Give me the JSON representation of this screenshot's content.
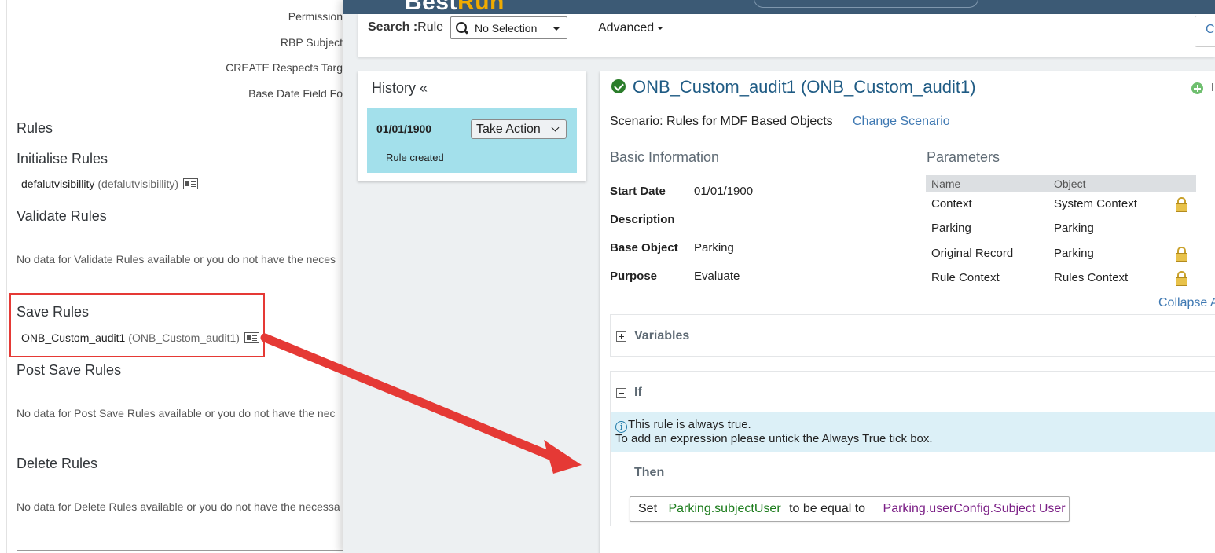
{
  "left_panel": {
    "fields": [
      "Permission",
      "RBP Subject",
      "CREATE Respects Targ",
      "Base Date Field Fo"
    ],
    "rules_heading": "Rules",
    "initialise": {
      "heading": "Initialise Rules",
      "rule_name": "defalutvisibillity",
      "rule_id": "(defalutvisibillity)"
    },
    "validate": {
      "heading": "Validate Rules",
      "no_data": "No data for Validate Rules available or you do not have the neces"
    },
    "save": {
      "heading": "Save Rules",
      "rule_name": "ONB_Custom_audit1",
      "rule_id": "(ONB_Custom_audit1)"
    },
    "post_save": {
      "heading": "Post Save Rules",
      "no_data": "No data for Post Save Rules available or you do not have the nec"
    },
    "delete": {
      "heading": "Delete Rules",
      "no_data": "No data for Delete Rules available or you do not have the necessa"
    }
  },
  "overlay": {
    "brand": {
      "part1": "Best",
      "part2": "Run"
    },
    "search": {
      "label_bold": "Search :",
      "label_rest": "Rule",
      "selected": "No Selection",
      "advanced": "Advanced",
      "edge_button": "C"
    },
    "history": {
      "title": "History «",
      "date": "01/01/1900",
      "take_action": "Take Action",
      "note": "Rule created"
    },
    "detail": {
      "title": "ONB_Custom_audit1 (ONB_Custom_audit1)",
      "add_label": "I",
      "scenario": "Scenario: Rules for MDF Based Objects",
      "change_scenario": "Change Scenario",
      "basic_info": {
        "title": "Basic Information",
        "rows": [
          {
            "label": "Start Date",
            "value": "01/01/1900"
          },
          {
            "label": "Description",
            "value": ""
          },
          {
            "label": "Base Object",
            "value": "Parking"
          },
          {
            "label": "Purpose",
            "value": "Evaluate"
          }
        ]
      },
      "parameters": {
        "title": "Parameters",
        "headers": [
          "Name",
          "Object"
        ],
        "rows": [
          {
            "name": "Context",
            "object": "System Context",
            "locked": true
          },
          {
            "name": "Parking",
            "object": "Parking",
            "locked": false
          },
          {
            "name": "Original Record",
            "object": "Parking",
            "locked": true
          },
          {
            "name": "Rule Context",
            "object": "Rules Context",
            "locked": true
          }
        ],
        "collapse": "Collapse A"
      },
      "variables_label": "Variables",
      "if_label": "If",
      "info_line1": "This rule is always true.",
      "info_line2": "To add an expression please untick the Always True tick box.",
      "then_label": "Then",
      "set_statement": {
        "keyword": "Set",
        "lhs": "Parking.subjectUser",
        "operator": "to be equal to",
        "rhs": "Parking.userConfig.Subject User"
      }
    }
  },
  "colors": {
    "shell": "#3c5a75",
    "brand_accent": "#f0ab00",
    "history_item": "#a3e0eb",
    "link": "#3e78b2",
    "highlight_red": "#e53935",
    "lhs_green": "#1b7b1b",
    "rhs_purple": "#7b1f86"
  }
}
